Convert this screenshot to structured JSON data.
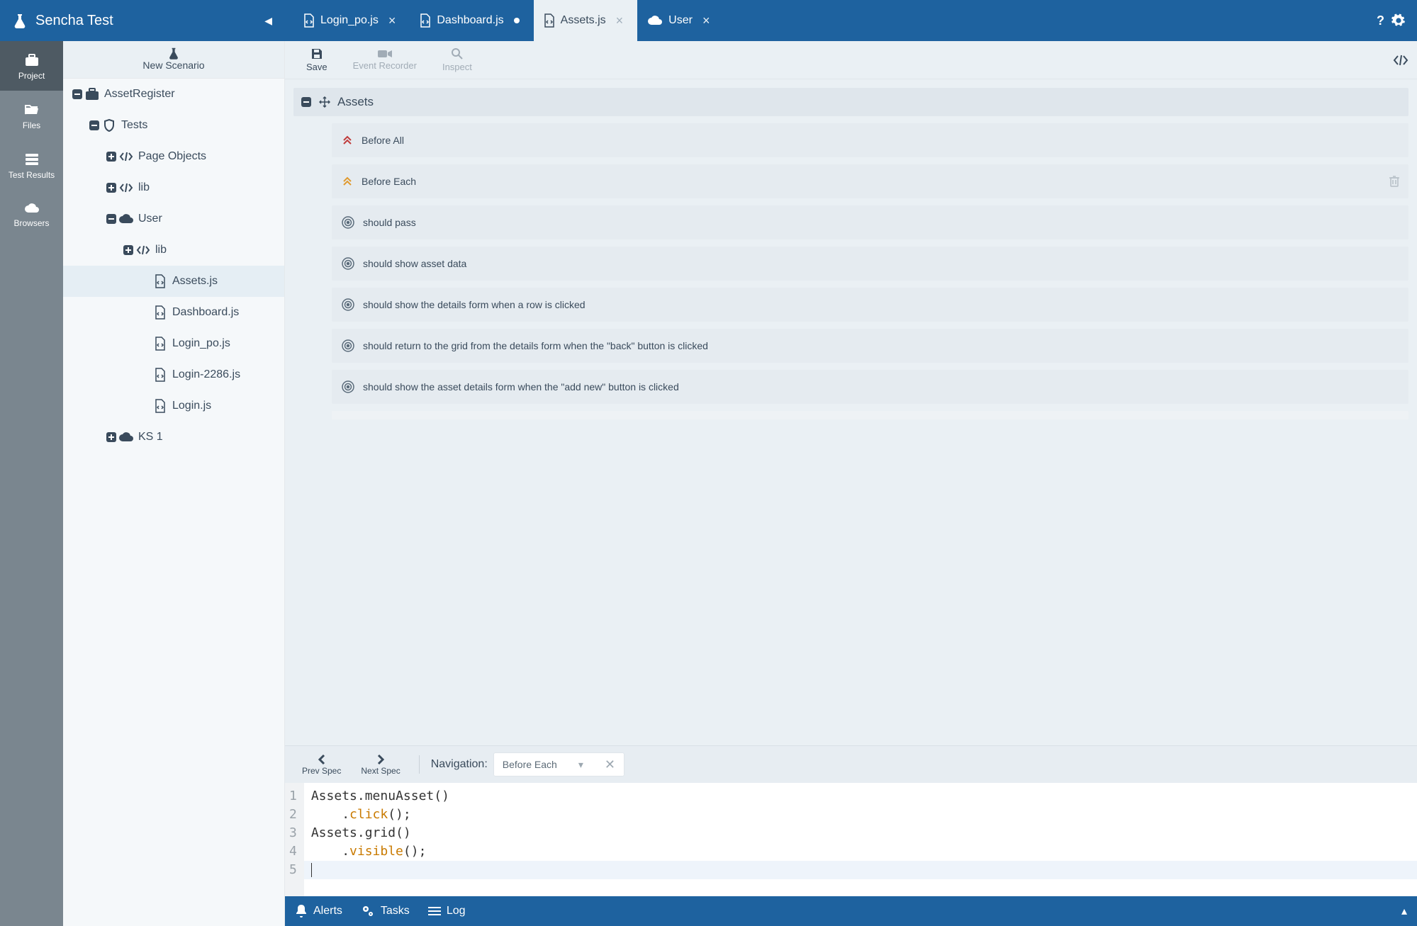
{
  "app": {
    "title": "Sencha Test"
  },
  "activity": {
    "items": [
      {
        "key": "project",
        "label": "Project",
        "icon": "briefcase",
        "active": true
      },
      {
        "key": "files",
        "label": "Files",
        "icon": "folder-open",
        "active": false
      },
      {
        "key": "test-results",
        "label": "Test Results",
        "icon": "server",
        "active": false
      },
      {
        "key": "browsers",
        "label": "Browsers",
        "icon": "cloud",
        "active": false
      }
    ]
  },
  "sideToolbar": {
    "newScenario": "New Scenario"
  },
  "tree": {
    "nodes": [
      {
        "depth": 1,
        "expand": "minus",
        "icon": "briefcase",
        "label": "AssetRegister"
      },
      {
        "depth": 2,
        "expand": "minus",
        "icon": "shield",
        "label": "Tests"
      },
      {
        "depth": 3,
        "expand": "plus",
        "icon": "code",
        "label": "Page Objects"
      },
      {
        "depth": 3,
        "expand": "plus",
        "icon": "code",
        "label": "lib"
      },
      {
        "depth": 3,
        "expand": "minus",
        "icon": "cloud",
        "label": "User"
      },
      {
        "depth": 4,
        "expand": "plus",
        "icon": "code",
        "label": "lib"
      },
      {
        "depth": 5,
        "expand": "",
        "icon": "file-code",
        "label": "Assets.js",
        "selected": true
      },
      {
        "depth": 5,
        "expand": "",
        "icon": "file-code",
        "label": "Dashboard.js"
      },
      {
        "depth": 5,
        "expand": "",
        "icon": "file-code",
        "label": "Login_po.js"
      },
      {
        "depth": 5,
        "expand": "",
        "icon": "file-code",
        "label": "Login-2286.js"
      },
      {
        "depth": 5,
        "expand": "",
        "icon": "file-code",
        "label": "Login.js"
      },
      {
        "depth": 3,
        "expand": "plus",
        "icon": "cloud",
        "label": "KS 1"
      }
    ]
  },
  "tabs": {
    "items": [
      {
        "icon": "file-code",
        "label": "Login_po.js",
        "close": "x",
        "active": false
      },
      {
        "icon": "file-code",
        "label": "Dashboard.js",
        "close": "dot",
        "active": false
      },
      {
        "icon": "file-code",
        "label": "Assets.js",
        "close": "x",
        "active": true
      },
      {
        "icon": "cloud",
        "label": "User",
        "close": "x",
        "active": false
      }
    ],
    "help": "?",
    "gear": "⚙"
  },
  "toolbar": {
    "save": "Save",
    "recorder": "Event Recorder",
    "inspect": "Inspect"
  },
  "suite": {
    "title": "Assets",
    "rows": [
      {
        "kind": "ba",
        "icon": "chev-up-double",
        "label": "Before All"
      },
      {
        "kind": "be",
        "icon": "chev-up-single",
        "label": "Before Each",
        "trash": true
      },
      {
        "kind": "it",
        "icon": "target",
        "label": "should pass"
      },
      {
        "kind": "it",
        "icon": "target",
        "label": "should show asset data"
      },
      {
        "kind": "it",
        "icon": "target",
        "label": "should show the details form when a row is clicked"
      },
      {
        "kind": "it",
        "icon": "target",
        "label": "should return to the grid from the details form when the \"back\" button is clicked"
      },
      {
        "kind": "it",
        "icon": "target",
        "label": "should show the asset details form when the \"add new\" button is clicked"
      }
    ]
  },
  "nav": {
    "prev": "Prev Spec",
    "next": "Next Spec",
    "label": "Navigation:",
    "select": "Before Each"
  },
  "code": {
    "lines": [
      "1",
      "2",
      "3",
      "4",
      "5"
    ],
    "tokens": [
      [
        {
          "t": "Assets",
          "c": "obj"
        },
        {
          "t": ".",
          "c": "punc"
        },
        {
          "t": "menuAsset",
          "c": "obj"
        },
        {
          "t": "()",
          "c": "punc"
        }
      ],
      [
        {
          "t": "    .",
          "c": "punc"
        },
        {
          "t": "click",
          "c": "method"
        },
        {
          "t": "();",
          "c": "punc"
        }
      ],
      [
        {
          "t": "Assets",
          "c": "obj"
        },
        {
          "t": ".",
          "c": "punc"
        },
        {
          "t": "grid",
          "c": "obj"
        },
        {
          "t": "()",
          "c": "punc"
        }
      ],
      [
        {
          "t": "    .",
          "c": "punc"
        },
        {
          "t": "visible",
          "c": "method"
        },
        {
          "t": "();",
          "c": "punc"
        }
      ],
      []
    ],
    "activeLine": 5
  },
  "status": {
    "alerts": "Alerts",
    "tasks": "Tasks",
    "log": "Log"
  },
  "colors": {
    "primary": "#1e629f"
  }
}
